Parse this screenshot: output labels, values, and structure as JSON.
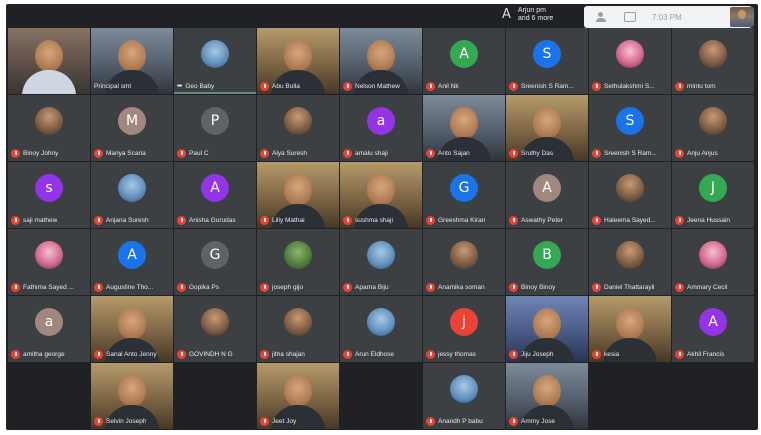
{
  "topbar": {
    "presenting_line1": "Arjun pm",
    "presenting_line2": "and 6 more",
    "presenting_icon": "A",
    "time": "7:03 PM"
  },
  "colors": {
    "background": "#202124",
    "mic_muted": "#ea4335",
    "tile": "#3c4043"
  },
  "participants": [
    {
      "name": "",
      "kind": "video",
      "tone": "light",
      "muted": false
    },
    {
      "name": "Principal smt",
      "kind": "video",
      "tone": "cool",
      "muted": false
    },
    {
      "name": "Geo Baby",
      "kind": "avatar",
      "initial": "",
      "color": "#3c4043",
      "photo": "sky",
      "muted": false,
      "dots": true
    },
    {
      "name": "Abu Bulla",
      "kind": "video",
      "tone": "warm",
      "muted": true
    },
    {
      "name": "Nelson Mathew",
      "kind": "video",
      "tone": "cool",
      "muted": true
    },
    {
      "name": "Anil Nk",
      "kind": "avatar",
      "initial": "A",
      "color": "#34a853",
      "muted": true
    },
    {
      "name": "Sreenish S Ram...",
      "kind": "avatar",
      "initial": "S",
      "color": "#1a73e8",
      "muted": true
    },
    {
      "name": "Sethulakshmi S...",
      "kind": "avatar",
      "initial": "",
      "color": "#3c4043",
      "photo": "pink",
      "muted": true
    },
    {
      "name": "mintu tom",
      "kind": "avatar",
      "initial": "",
      "color": "#3c4043",
      "photo": "default",
      "muted": true
    },
    {
      "name": "Binoy Johny",
      "kind": "avatar",
      "initial": "",
      "color": "#3c4043",
      "photo": "default",
      "muted": true
    },
    {
      "name": "Mariya Scaria",
      "kind": "avatar",
      "initial": "M",
      "color": "#a1887f",
      "muted": true
    },
    {
      "name": "Paul C",
      "kind": "avatar",
      "initial": "P",
      "color": "#5f6368",
      "muted": true
    },
    {
      "name": "Alya Suresh",
      "kind": "avatar",
      "initial": "",
      "color": "#3c4043",
      "photo": "default",
      "muted": true
    },
    {
      "name": "amalu shaji",
      "kind": "avatar",
      "initial": "a",
      "color": "#9334e6",
      "muted": true
    },
    {
      "name": "Anto Sajan",
      "kind": "video",
      "tone": "cool",
      "muted": true
    },
    {
      "name": "Sruthy Das",
      "kind": "video",
      "tone": "warm",
      "muted": true
    },
    {
      "name": "Sreenish S Ram...",
      "kind": "avatar",
      "initial": "S",
      "color": "#1a73e8",
      "muted": true
    },
    {
      "name": "Anju Anjus",
      "kind": "avatar",
      "initial": "",
      "color": "#3c4043",
      "photo": "default",
      "muted": true
    },
    {
      "name": "saji mathew",
      "kind": "avatar",
      "initial": "s",
      "color": "#9334e6",
      "muted": true
    },
    {
      "name": "Anjana Suresh",
      "kind": "avatar",
      "initial": "",
      "color": "#3c4043",
      "photo": "sky",
      "muted": true
    },
    {
      "name": "Anisha Gurudas",
      "kind": "avatar",
      "initial": "A",
      "color": "#9334e6",
      "muted": true
    },
    {
      "name": "Lilly Mathai",
      "kind": "video",
      "tone": "warm",
      "muted": true
    },
    {
      "name": "sushma shaji",
      "kind": "video",
      "tone": "warm",
      "muted": true
    },
    {
      "name": "Greeshma Kiran",
      "kind": "avatar",
      "initial": "G",
      "color": "#1a73e8",
      "muted": true
    },
    {
      "name": "Aswathy Peter",
      "kind": "avatar",
      "initial": "A",
      "color": "#a1887f",
      "muted": true
    },
    {
      "name": "Haleema Sayed...",
      "kind": "avatar",
      "initial": "",
      "color": "#3c4043",
      "photo": "default",
      "muted": true
    },
    {
      "name": "Jeena Hussain",
      "kind": "avatar",
      "initial": "J",
      "color": "#34a853",
      "muted": true
    },
    {
      "name": "Fathima Sayed ...",
      "kind": "avatar",
      "initial": "",
      "color": "#3c4043",
      "photo": "pink",
      "muted": true
    },
    {
      "name": "Augustine Tho...",
      "kind": "avatar",
      "initial": "A",
      "color": "#1a73e8",
      "muted": true
    },
    {
      "name": "Gopika Ps",
      "kind": "avatar",
      "initial": "G",
      "color": "#5f6368",
      "muted": true
    },
    {
      "name": "joseph gijo",
      "kind": "avatar",
      "initial": "",
      "color": "#3c4043",
      "photo": "green",
      "muted": true
    },
    {
      "name": "Aparna Biju",
      "kind": "avatar",
      "initial": "",
      "color": "#3c4043",
      "photo": "sky",
      "muted": true
    },
    {
      "name": "Anamika soman",
      "kind": "avatar",
      "initial": "",
      "color": "#3c4043",
      "photo": "default",
      "muted": true
    },
    {
      "name": "Binoy Binoy",
      "kind": "avatar",
      "initial": "B",
      "color": "#34a853",
      "muted": true
    },
    {
      "name": "Daniel Thattarayil",
      "kind": "avatar",
      "initial": "",
      "color": "#3c4043",
      "photo": "default",
      "muted": true
    },
    {
      "name": "Ammary Cecil",
      "kind": "avatar",
      "initial": "",
      "color": "#3c4043",
      "photo": "pink",
      "muted": true
    },
    {
      "name": "amitha george",
      "kind": "avatar",
      "initial": "a",
      "color": "#a1887f",
      "muted": true
    },
    {
      "name": "Sanal Anto Jenny",
      "kind": "video",
      "tone": "warm",
      "muted": true
    },
    {
      "name": "GOVINDH N G",
      "kind": "avatar",
      "initial": "",
      "color": "#3c4043",
      "photo": "default",
      "muted": true
    },
    {
      "name": "jitha shajan",
      "kind": "avatar",
      "initial": "",
      "color": "#3c4043",
      "photo": "default",
      "muted": true
    },
    {
      "name": "Arun Eldhose",
      "kind": "avatar",
      "initial": "",
      "color": "#3c4043",
      "photo": "sky",
      "muted": true
    },
    {
      "name": "jessy thomas",
      "kind": "avatar",
      "initial": "j",
      "color": "#ea4335",
      "muted": true
    },
    {
      "name": "Jiju Joseph",
      "kind": "video",
      "tone": "blue",
      "muted": true
    },
    {
      "name": "kesia",
      "kind": "video",
      "tone": "warm",
      "muted": true
    },
    {
      "name": "Akhil Francis",
      "kind": "avatar",
      "initial": "A",
      "color": "#9334e6",
      "muted": true
    },
    {
      "name": "",
      "kind": "empty"
    },
    {
      "name": "Selvin Joseph",
      "kind": "video",
      "tone": "warm",
      "muted": true
    },
    {
      "name": "",
      "kind": "empty"
    },
    {
      "name": "Jeet Joy",
      "kind": "video",
      "tone": "warm",
      "muted": true
    },
    {
      "name": "",
      "kind": "empty"
    },
    {
      "name": "Anandh P babu",
      "kind": "avatar",
      "initial": "",
      "color": "#3c4043",
      "photo": "sky",
      "muted": true
    },
    {
      "name": "Ammy Jose",
      "kind": "video",
      "tone": "cool",
      "muted": true
    },
    {
      "name": "",
      "kind": "empty"
    },
    {
      "name": "",
      "kind": "empty"
    }
  ]
}
